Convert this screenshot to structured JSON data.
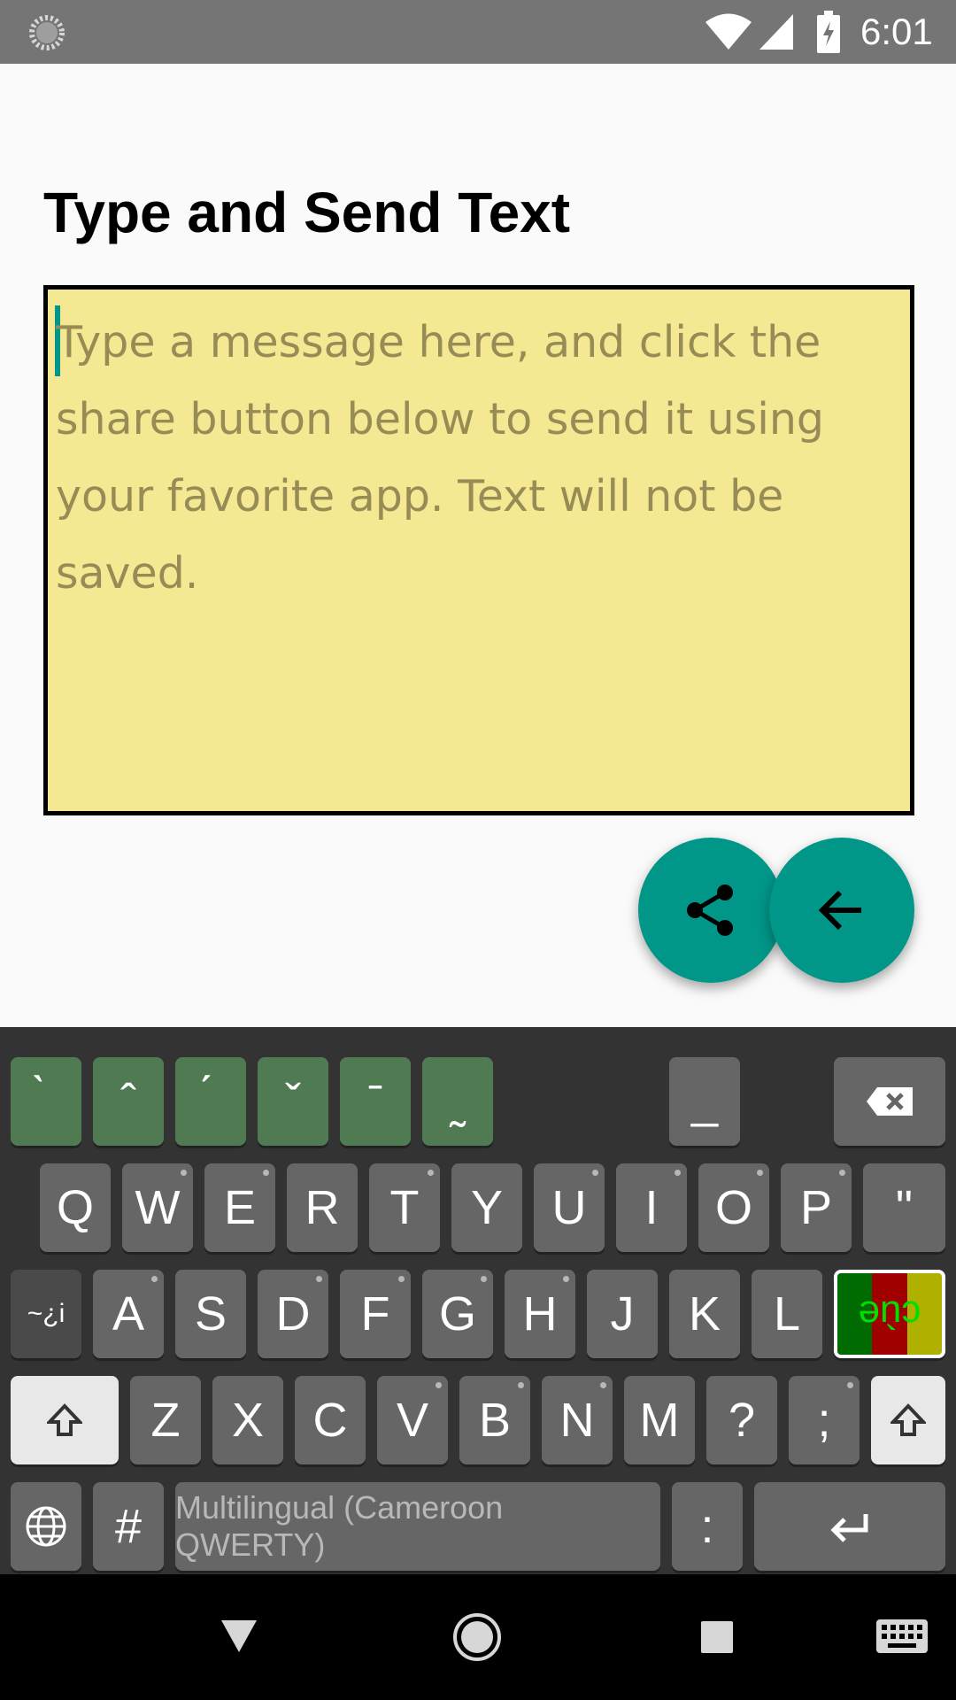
{
  "status_bar": {
    "time": "6:01",
    "icons": [
      "loading-icon",
      "wifi-icon",
      "cell-signal-icon",
      "battery-charging-icon"
    ],
    "background": "#757575"
  },
  "app": {
    "title": "Type and Send Text",
    "message": {
      "value": "",
      "placeholder": "Type a message here, and click the share button below to send it using your favorite app. Text will not be saved."
    },
    "accent_color": "#009688",
    "box_color": "#f5e893",
    "share_icon": "share-icon",
    "back_icon": "arrow-back-icon"
  },
  "keyboard": {
    "diacritic_row": [
      "̀",
      "̂",
      "́",
      "̌",
      "̄",
      "̰"
    ],
    "underscore_key": "_",
    "row1": [
      "Q",
      "W",
      "E",
      "R",
      "T",
      "Y",
      "U",
      "I",
      "O",
      "P",
      "\""
    ],
    "row2_symbol_key": "~¿i",
    "row2": [
      "A",
      "S",
      "D",
      "F",
      "G",
      "H",
      "J",
      "K",
      "L"
    ],
    "flag_key_label": "cùe",
    "flag_colors": [
      "#006b00",
      "#a00000",
      "#b0b000"
    ],
    "row3": [
      "Z",
      "X",
      "C",
      "V",
      "B",
      "N",
      "M",
      "?",
      ";"
    ],
    "hash_key": "#",
    "space_label": "Multilingual (Cameroon QWERTY)",
    "colon_key": ":"
  },
  "nav_bar": {
    "icons": [
      "back-triangle-icon",
      "home-circle-icon",
      "recents-square-icon",
      "keyboard-icon"
    ]
  }
}
